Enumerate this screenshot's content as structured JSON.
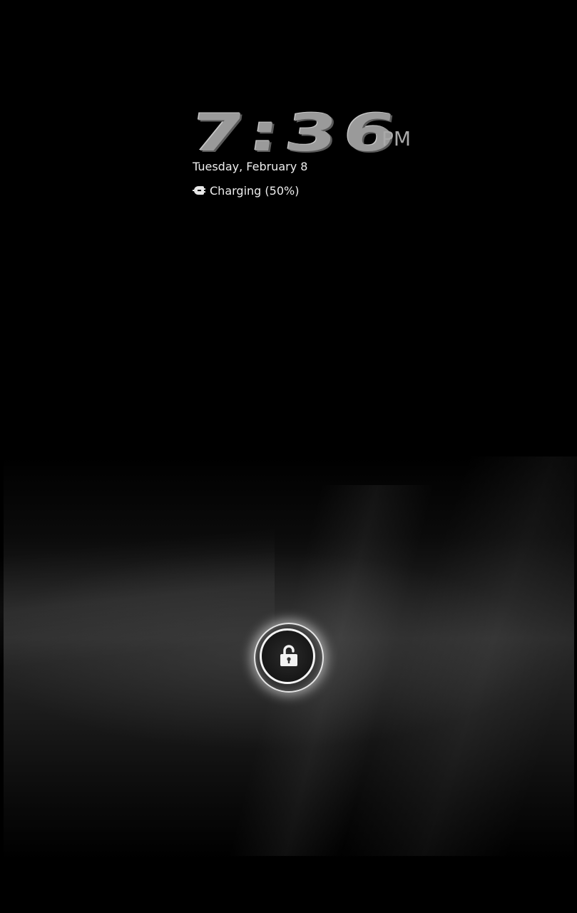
{
  "lockscreen": {
    "clock": {
      "time": "7:36",
      "ampm": "PM"
    },
    "date": "Tuesday, February 8",
    "status": {
      "icon": "charging-icon",
      "text": "Charging (50%)",
      "battery_percent": 50
    },
    "unlock": {
      "icon": "unlock-icon"
    }
  },
  "colors": {
    "background": "#000000",
    "clock_digits": "#9a9a9a",
    "text": "#eeeeee",
    "ring_glow": "#ffffff"
  }
}
